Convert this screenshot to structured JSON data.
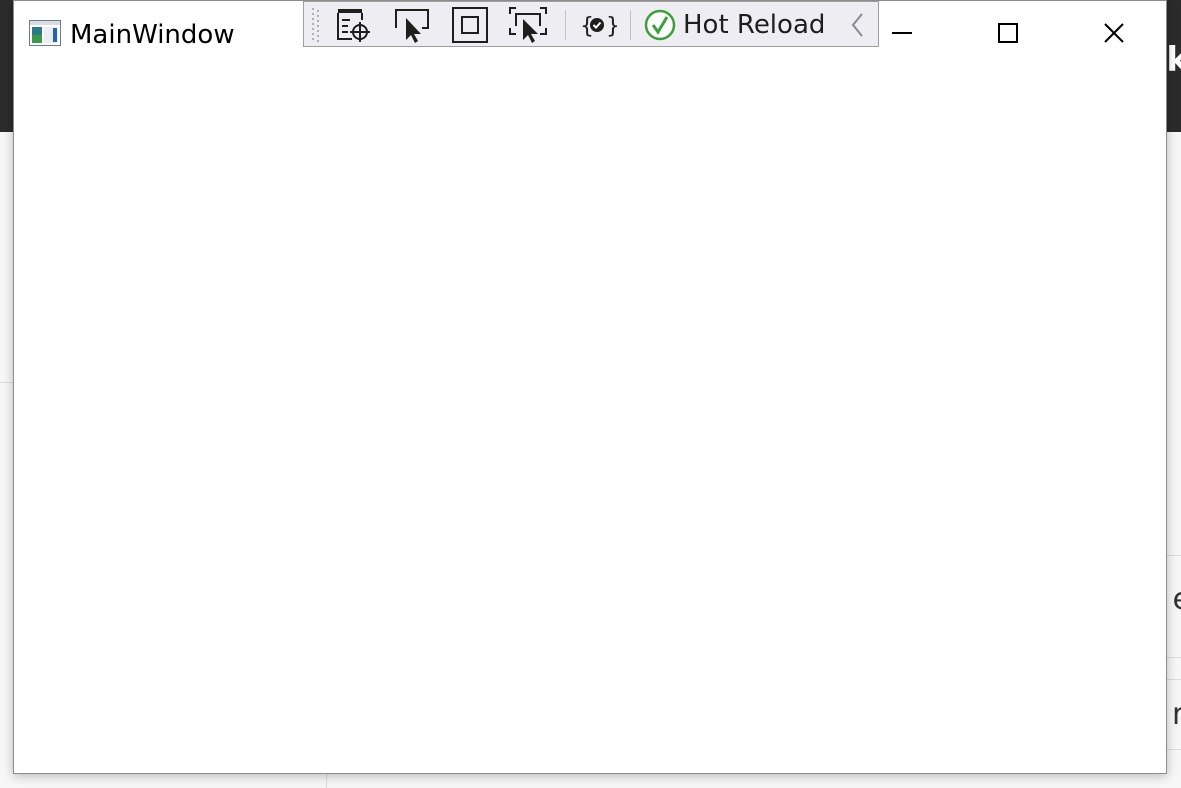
{
  "window": {
    "title": "MainWindow"
  },
  "dev_toolbar": {
    "hot_reload_label": "Hot Reload",
    "hot_reload_status_color": "#3c9e3c"
  },
  "background_app": {
    "header_fragment": "rk",
    "row_fragments": [
      "e",
      "n"
    ]
  },
  "icons": {
    "app": "window-app-icon",
    "minimize": "minimize-icon",
    "maximize": "maximize-icon",
    "close": "close-icon",
    "live_tree": "live-visual-tree-icon",
    "select_element": "select-element-icon",
    "display_adorners": "display-adorners-icon",
    "track_focus": "track-focused-element-icon",
    "binding_failures": "binding-failures-icon",
    "hot_reload": "check-circle-icon",
    "collapse": "chevron-left-icon"
  }
}
